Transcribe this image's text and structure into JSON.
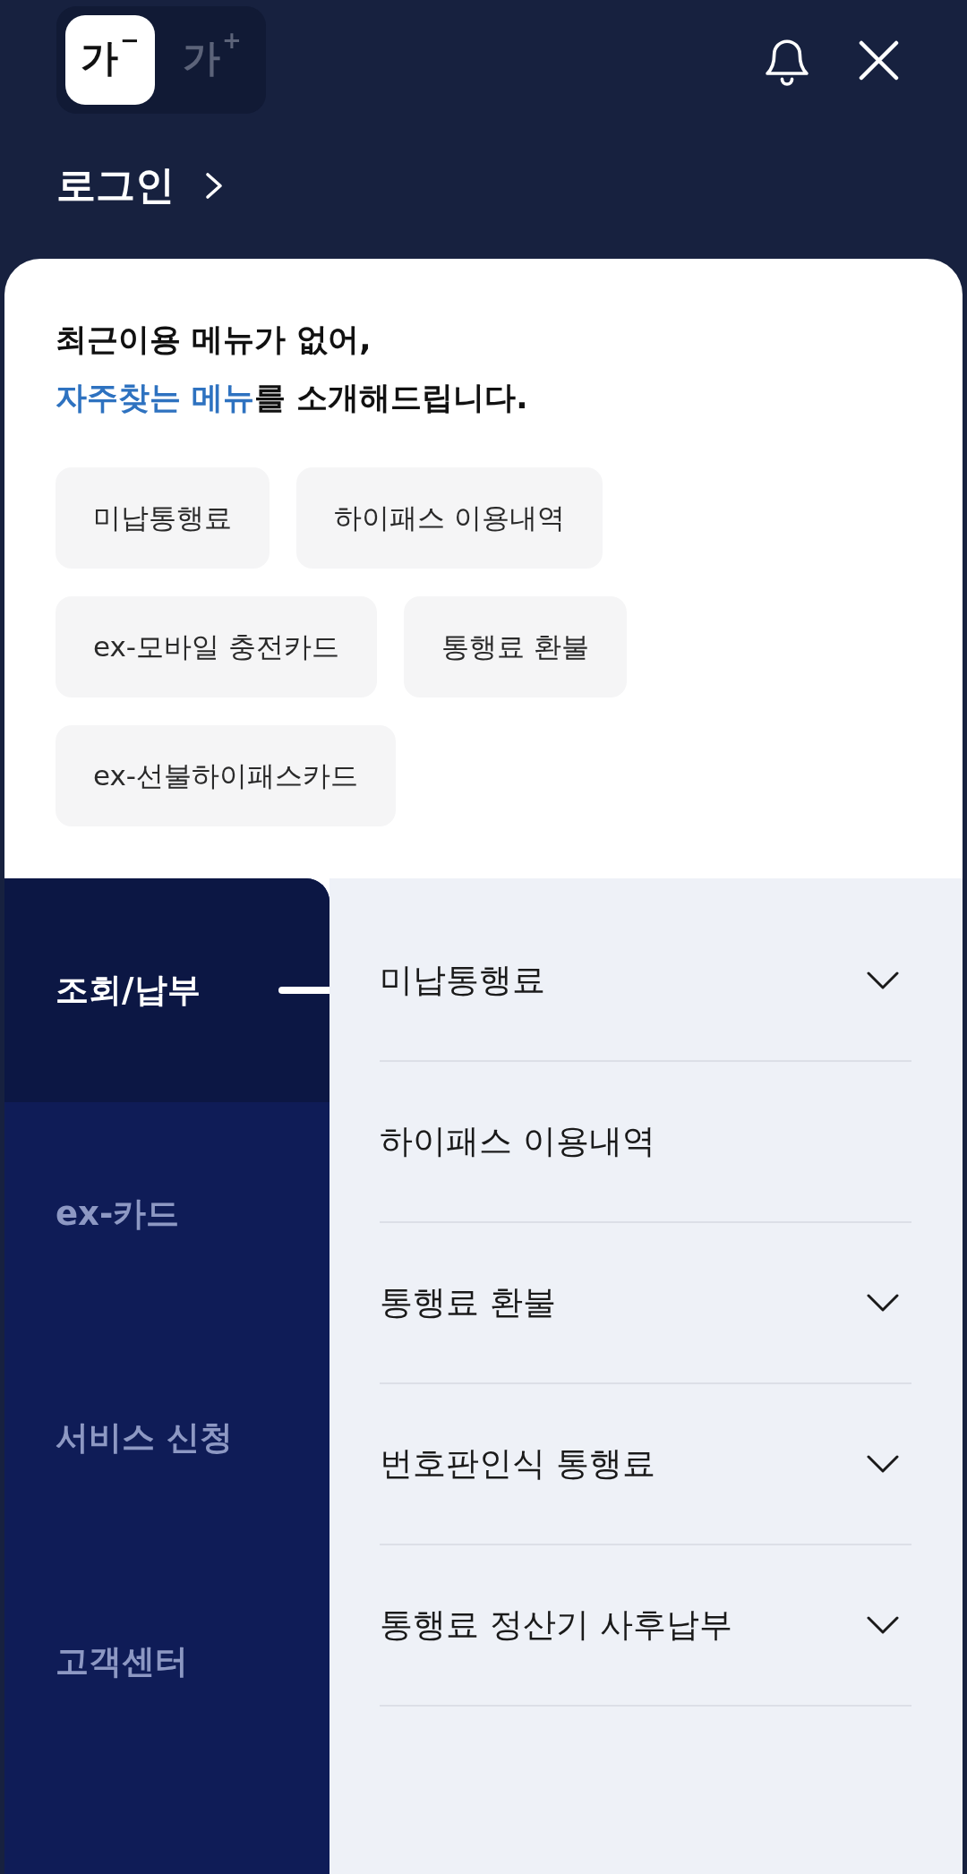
{
  "header": {
    "font_size_buttons": [
      {
        "label": "가$^{−}$",
        "selected": true
      },
      {
        "label": "가$^{+}$",
        "selected": false
      }
    ],
    "login": {
      "label": "로그인"
    }
  },
  "recent_menu": {
    "message_lines": [
      [
        {
          "text": "최근이용 메뉴가 없어,",
          "highlight": false
        }
      ],
      [
        {
          "text": "자주찾는 메뉴",
          "highlight": true
        },
        {
          "text": "를 소개해드립니다.",
          "highlight": false
        }
      ]
    ],
    "chips": [
      "미납통행료",
      "하이패스 이용내역",
      "ex-모바일 충전카드",
      "통행료 환불",
      "ex-선불하이패스카드"
    ]
  },
  "sidebar": {
    "items": [
      {
        "label": "조회/납부",
        "selected": true
      },
      {
        "label": "ex-카드",
        "selected": false
      },
      {
        "label": "서비스 신청",
        "selected": false
      },
      {
        "label": "고객센터",
        "selected": false
      }
    ]
  },
  "submenu": {
    "items": [
      {
        "label": "미납통행료",
        "kind": "group"
      },
      {
        "label": "하이패스 이용내역",
        "kind": "link"
      },
      {
        "label": "통행료 환불",
        "kind": "group"
      },
      {
        "label": "번호판인식 통행료",
        "kind": "group"
      },
      {
        "label": "통행료 정산기 사후납부",
        "kind": "group"
      }
    ]
  }
}
